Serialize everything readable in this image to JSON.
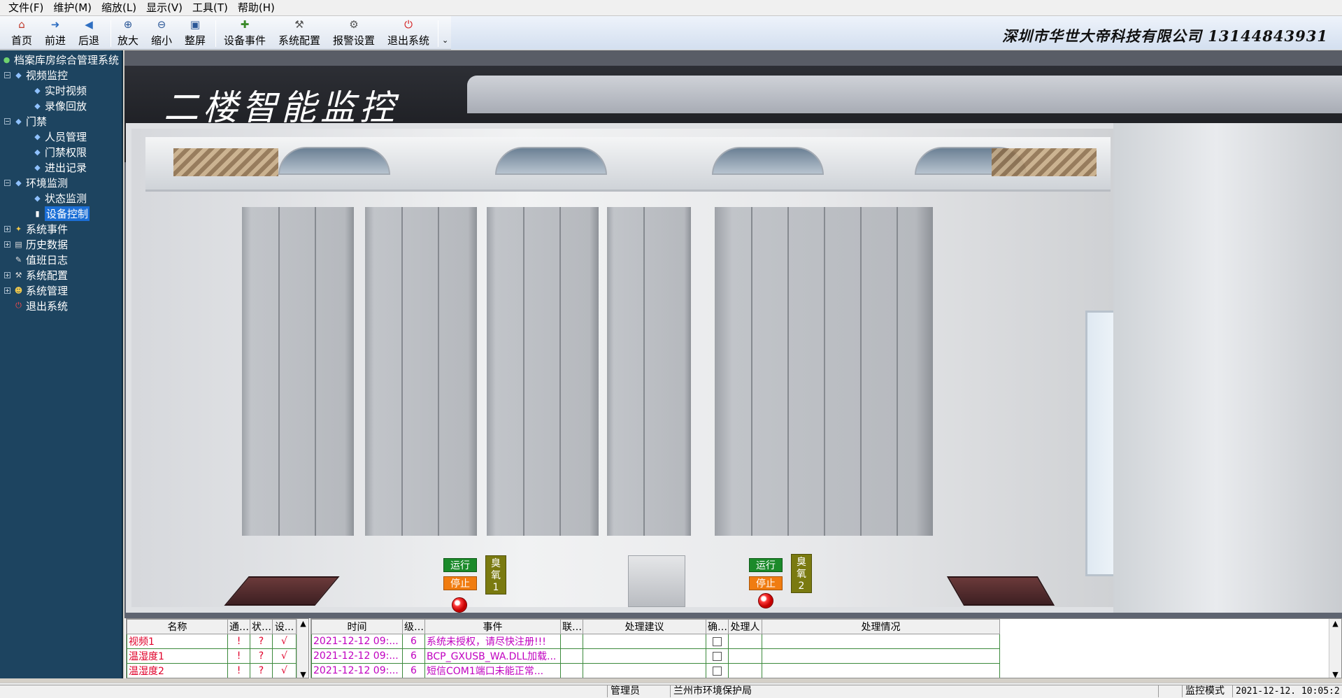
{
  "menus": [
    "文件(F)",
    "维护(M)",
    "缩放(L)",
    "显示(V)",
    "工具(T)",
    "帮助(H)"
  ],
  "toolbar": {
    "home": "首页",
    "forward": "前进",
    "back": "后退",
    "zoom_in": "放大",
    "zoom_out": "缩小",
    "fit": "整屏",
    "device_events": "设备事件",
    "system_config": "系统配置",
    "alarm_settings": "报警设置",
    "exit": "退出系统",
    "more": "⌄",
    "company": "深圳市华世大帝科技有限公司   13144843931"
  },
  "tree": {
    "root": "档案库房综合管理系统",
    "video": "视频监控",
    "realtime": "实时视频",
    "playback": "录像回放",
    "access": "门禁",
    "personnel": "人员管理",
    "permissions": "门禁权限",
    "records": "进出记录",
    "env": "环境监测",
    "status": "状态监测",
    "device_control": "设备控制",
    "sys_events": "系统事件",
    "history": "历史数据",
    "duty_log": "值班日志",
    "sys_config": "系统配置",
    "sys_manage": "系统管理",
    "exit": "退出系统"
  },
  "page": {
    "title": "二楼智能监控"
  },
  "devices": [
    {
      "run": "运行",
      "stop": "停止",
      "label": "臭\n氧\n1"
    },
    {
      "run": "运行",
      "stop": "停止",
      "label": "臭\n氧\n2"
    }
  ],
  "left_grid": {
    "headers": [
      "名称",
      "通...",
      "状...",
      "设..."
    ],
    "rows": [
      [
        "视频1",
        "!",
        "?",
        "√"
      ],
      [
        "温湿度1",
        "!",
        "?",
        "√"
      ],
      [
        "温湿度2",
        "!",
        "?",
        "√"
      ]
    ]
  },
  "right_grid": {
    "headers": [
      "时间",
      "级...",
      "事件",
      "联...",
      "处理建议",
      "确...",
      "处理人",
      "处理情况"
    ],
    "rows": [
      [
        "2021-12-12 09:...",
        "6",
        "系统未授权，请尽快注册!!!",
        "",
        "",
        "",
        "",
        ""
      ],
      [
        "2021-12-12 09:...",
        "6",
        "BCP_GXUSB_WA.DLL加载...",
        "",
        "",
        "",
        "",
        ""
      ],
      [
        "2021-12-12 09:...",
        "6",
        "短信COM1端口未能正常...",
        "",
        "",
        "",
        "",
        ""
      ]
    ]
  },
  "status": {
    "user": "管理员",
    "org": "兰州市环境保护局",
    "mode": "监控模式",
    "time": "2021-12-12. 10:05:2"
  },
  "colors": {
    "sidebar": "#1d4460",
    "selected": "#1b6fd6",
    "run": "#1b8a2a",
    "stop": "#f07c10",
    "alarm_text": "#e0002a",
    "event_text": "#c000c0"
  }
}
